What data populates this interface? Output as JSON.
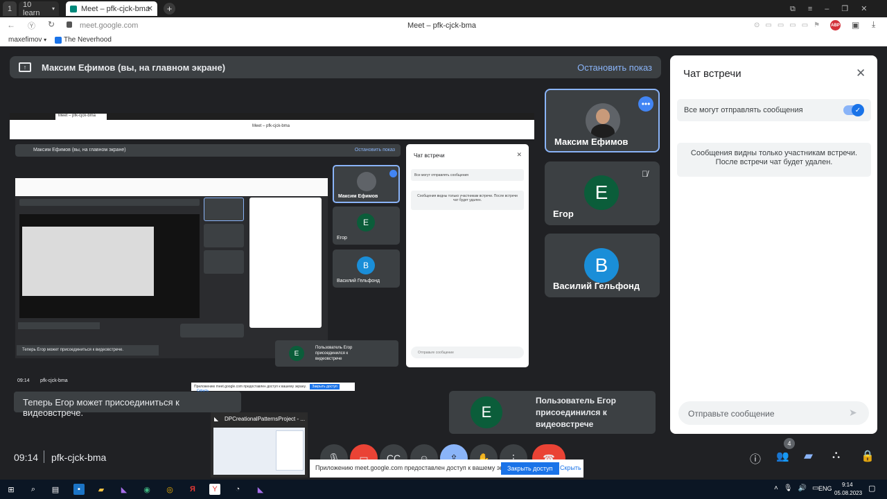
{
  "browser": {
    "tab1_count": "1",
    "tab1_label": "10 learn",
    "tab2_title": "Meet – pfk-cjck-bma",
    "url": "meet.google.com",
    "page_title": "Meet – pfk-cjck-bma",
    "bookmarks": [
      "maxefimov",
      "The Neverhood"
    ],
    "abp_label": "ABP"
  },
  "banner": {
    "text": "Максим Ефимов (вы, на главном экране)",
    "stop_label": "Остановить показ"
  },
  "screenshare": {
    "inner_title": "Meet – pfk-cjck-bma",
    "inner_banner": "Максим Ефимов (вы, на главном экране)",
    "inner_stop": "Остановить показ",
    "inner_chat_title": "Чат встречи",
    "inner_chat_toggle": "Все могут отправлять сообщения",
    "inner_chat_notice": "Сообщения видны только участникам встречи. После встречи чат будет удален.",
    "inner_chat_placeholder": "Отправьте сообщение",
    "inner_tiles": [
      "Максим Ефимов",
      "Егор",
      "Василий Гельфонд"
    ],
    "inner_toast": "Теперь Егор может присоединиться к видеовстрече.",
    "inner_joined": "Пользователь Егор присоединился к видеовстрече",
    "inner_time": "09:14",
    "inner_code": "pfk-cjck-bma",
    "inner_share_text": "Приложению meet.google.com предоставлен доступ к вашему экрану.",
    "inner_share_close": "Закрыть доступ",
    "inner_share_hide": "Скрыть"
  },
  "participants": [
    {
      "name": "Максим Ефимов",
      "initial": "",
      "color": "#5f6368"
    },
    {
      "name": "Егор",
      "initial": "Е",
      "color": "#0b5d3a"
    },
    {
      "name": "Василий Гельфонд",
      "initial": "В",
      "color": "#1a8ed8"
    }
  ],
  "chat": {
    "title": "Чат встречи",
    "toggle_label": "Все могут отправлять сообщения",
    "notice": "Сообщения видны только участникам встречи. После встречи чат будет удален.",
    "input_placeholder": "Отправьте сообщение"
  },
  "toast": "Теперь Егор может присоединиться к видеовстрече.",
  "joined": {
    "initial": "Е",
    "text": "Пользователь Егор присоединился к видеовстрече"
  },
  "bottom": {
    "time": "09:14",
    "code": "pfk-cjck-bma",
    "people_count": "4"
  },
  "taskbar_preview": {
    "title": "DPCreationalPatternsProject - ..."
  },
  "share_bar": {
    "text": "Приложению meet.google.com предоставлен доступ к вашему экрану.",
    "close_label": "Закрыть доступ",
    "hide_label": "Скрыть"
  },
  "tray": {
    "lang": "ENG",
    "time": "9:14",
    "date": "05.08.2023"
  },
  "colors": {
    "accent": "#8ab4f8",
    "blue": "#1a73e8",
    "red": "#ea4335",
    "bg": "#202124",
    "tile": "#3c4043"
  }
}
